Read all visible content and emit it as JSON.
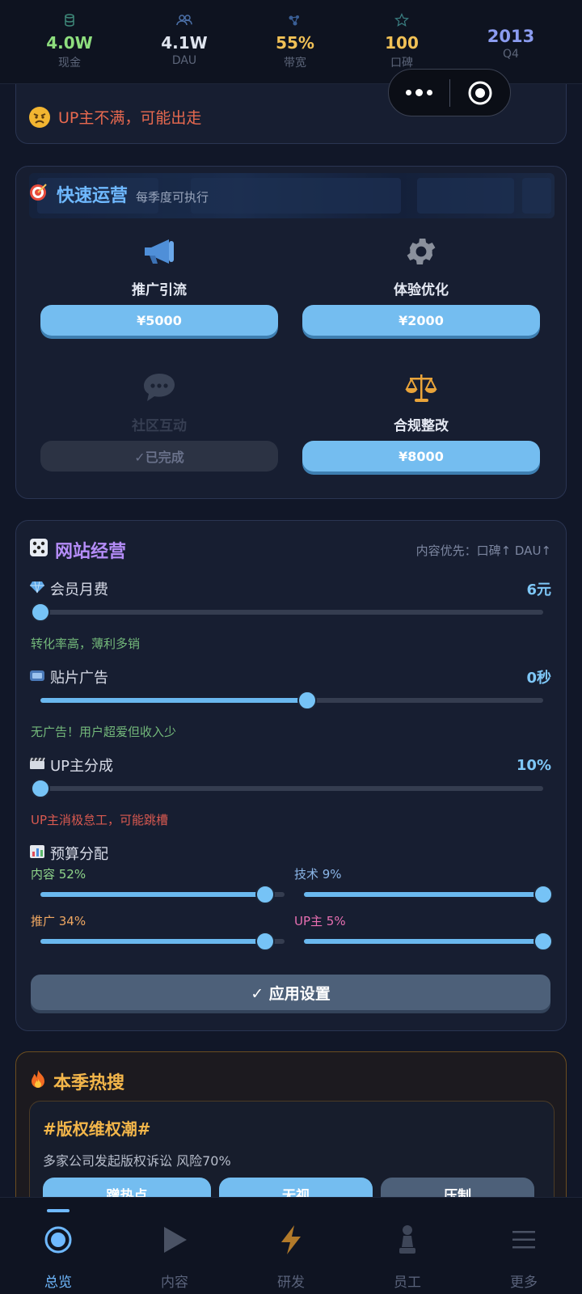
{
  "stats": [
    {
      "value": "4.0W",
      "label": "现金",
      "color": "#8ede7e",
      "icon": "cash-icon"
    },
    {
      "value": "4.1W",
      "label": "DAU",
      "color": "#dfe4ee",
      "icon": "users-icon"
    },
    {
      "value": "55%",
      "label": "带宽",
      "color": "#f1c156",
      "icon": "bandwidth-icon"
    },
    {
      "value": "100",
      "label": "口碑",
      "color": "#f1c156",
      "icon": "star-icon"
    },
    {
      "value": "2013",
      "label": "Q4",
      "color": "#8b9cf0",
      "icon": ""
    }
  ],
  "event": {
    "text": "UP主不满，可能出走"
  },
  "quick": {
    "title": "快速运营",
    "subtitle": "每季度可执行",
    "ops": [
      {
        "name": "推广引流",
        "button": "¥5000",
        "icon": "megaphone-icon",
        "done": false
      },
      {
        "name": "体验优化",
        "button": "¥2000",
        "icon": "gear-icon",
        "done": false
      },
      {
        "name": "社区互动",
        "button": "✓已完成",
        "icon": "chat-icon",
        "done": true
      },
      {
        "name": "合规整改",
        "button": "¥8000",
        "icon": "scales-icon",
        "done": false
      }
    ]
  },
  "site": {
    "title": "网站经营",
    "hint": "内容优先：口碑↑ DAU↑",
    "membership": {
      "label": "会员月费",
      "value": "6元",
      "level": 0.0,
      "note": "转化率高，薄利多销"
    },
    "ads": {
      "label": "贴片广告",
      "value": "0秒",
      "level": 0.53,
      "note": "无广告！用户超爱但收入少"
    },
    "share": {
      "label": "UP主分成",
      "value": "10%",
      "level": 0.0,
      "note": "UP主消极怠工，可能跳槽"
    },
    "budget_title": "预算分配",
    "budget": [
      {
        "label": "内容 52%",
        "color": "#8fd58a",
        "level": 0.92
      },
      {
        "label": "技术 9%",
        "color": "#8bb6e8",
        "level": 1.0
      },
      {
        "label": "推广 34%",
        "color": "#f0a862",
        "level": 0.92
      },
      {
        "label": "UP主 5%",
        "color": "#e76fb1",
        "level": 1.0
      }
    ],
    "apply_label": "✓ 应用设置"
  },
  "hot": {
    "title": "本季热搜",
    "tag": "#版权维权潮#",
    "desc": "多家公司发起版权诉讼 风险70%",
    "buttons": [
      "蹭热点",
      "无视",
      "压制"
    ]
  },
  "nav": [
    {
      "label": "总览",
      "icon": "overview-icon",
      "active": true
    },
    {
      "label": "内容",
      "icon": "play-icon",
      "active": false
    },
    {
      "label": "研发",
      "icon": "lightning-icon",
      "active": false
    },
    {
      "label": "员工",
      "icon": "pawn-icon",
      "active": false
    },
    {
      "label": "更多",
      "icon": "menu-icon",
      "active": false
    }
  ]
}
